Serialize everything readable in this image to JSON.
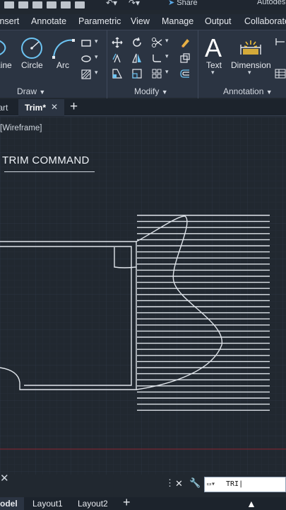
{
  "app": {
    "brand": "Autodesk",
    "share_label": "Share"
  },
  "ribbon_tabs": [
    "Insert",
    "Annotate",
    "Parametric",
    "View",
    "Manage",
    "Output",
    "Collaborate"
  ],
  "ribbon": {
    "draw_tools": [
      "Line",
      "Circle",
      "Arc"
    ],
    "annotation_tools": [
      "Text",
      "Dimension"
    ],
    "panels": [
      "Draw",
      "Modify",
      "Annotation"
    ]
  },
  "doc_tabs": {
    "start": "Start",
    "active": "Trim*",
    "add": "+"
  },
  "canvas": {
    "view_label": "[Wireframe]",
    "title": "TRIM COMMAND",
    "accent_color": "#8a2430"
  },
  "command": {
    "input_value": "TRI"
  },
  "layout_tabs": [
    "Model",
    "Layout1",
    "Layout2"
  ],
  "layout_add": "+"
}
